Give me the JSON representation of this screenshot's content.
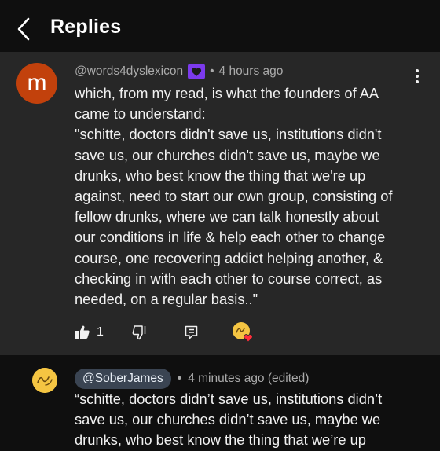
{
  "header": {
    "title": "Replies",
    "back_icon": "chevron-left-icon"
  },
  "comment": {
    "avatar_letter": "m",
    "avatar_color": "#c2410c",
    "author": "@words4dyslexicon",
    "separator": "•",
    "time": "4 hours ago",
    "member_badge_color": "#7c3aed",
    "text": "which, from my read, is what the founders of AA\ncame to understand:\n\"schitte, doctors didn't save us, institutions didn't\nsave us, our churches didn't save us, maybe we\ndrunks, who best know the thing that we're up\nagainst, need to start our own group, consisting of\nfellow drunks, where we can talk honestly about\nour conditions in life & help each other to change\ncourse, one recovering addict helping another, &\nchecking in with each other to course correct, as\nneeded, on a regular basis..\"",
    "like_count": "1",
    "icons": [
      "thumbs-up-icon",
      "thumbs-down-icon",
      "reply-icon",
      "creator-heart-icon",
      "more-vert-icon"
    ]
  },
  "reply": {
    "author": "@SoberJames",
    "separator": "•",
    "time": "4 minutes ago (edited)",
    "text": "“schitte, doctors didn’t save us, institutions didn’t\nsave us, our churches didn’t save us, maybe we\ndrunks, who best know the thing that we’re up"
  }
}
